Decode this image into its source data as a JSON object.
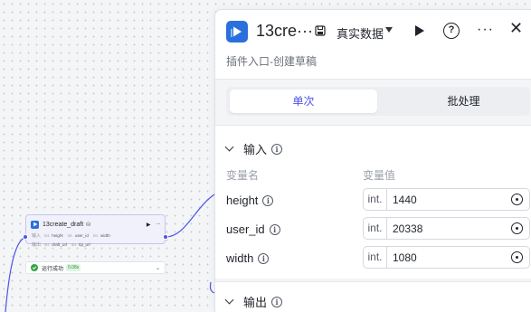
{
  "canvas_node": {
    "title": "13create_draft",
    "input_label": "输入",
    "output_label": "输出",
    "inputs": [
      {
        "type": "int.",
        "name": "height"
      },
      {
        "type": "int.",
        "name": "user_id"
      },
      {
        "type": "int.",
        "name": "width"
      }
    ],
    "outputs": [
      {
        "type": "str.",
        "name": "draft_url"
      },
      {
        "type": "str.",
        "name": "tip_url"
      }
    ],
    "status_text": "运行成功",
    "duration": "0.08s"
  },
  "panel": {
    "title": "13cre···",
    "mode_label": "真实数据",
    "subtitle": "插件入口-创建草稿",
    "tabs": [
      {
        "label": "单次",
        "active": true
      },
      {
        "label": "批处理",
        "active": false
      }
    ],
    "input_section": {
      "title": "输入",
      "col_name": "变量名",
      "col_value": "变量值",
      "params": [
        {
          "name": "height",
          "type": "int.",
          "value": "1440"
        },
        {
          "name": "user_id",
          "type": "int.",
          "value": "20338"
        },
        {
          "name": "width",
          "type": "int.",
          "value": "1080"
        }
      ]
    },
    "output_section": {
      "title": "输出"
    }
  },
  "colors": {
    "accent": "#4d53e8",
    "brand_logo": "#2b6fde",
    "success": "#32a645"
  }
}
